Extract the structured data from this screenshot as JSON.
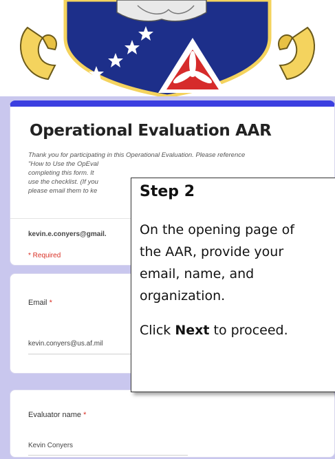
{
  "form": {
    "title": "Operational Evaluation AAR",
    "description_lines": [
      "Thank you for participating in this Operational Evaluation. Please reference",
      "\"How to Use the OpEval",
      "completing this form.  It",
      "use the checklist.  (If you",
      "please email them to ke"
    ],
    "account": "kevin.e.conyers@gmail.",
    "required_note": "* Required"
  },
  "questions": [
    {
      "label": "Email",
      "required_mark": "*",
      "answer": "kevin.conyers@us.af.mil"
    },
    {
      "label": "Evaluator name",
      "required_mark": "*",
      "answer": "Kevin Conyers"
    }
  ],
  "callout": {
    "title": "Step 2",
    "body_lines": [
      "On the opening page of",
      "the AAR, provide your",
      "email, name, and",
      "organization."
    ],
    "next_prefix": "Click ",
    "next_bold": "Next",
    "next_suffix": " to proceed."
  },
  "colors": {
    "page_bg": "#c9c7ee",
    "accent": "#3b3fe0",
    "required": "#d93025"
  },
  "icons": [
    "emblem-logo"
  ]
}
